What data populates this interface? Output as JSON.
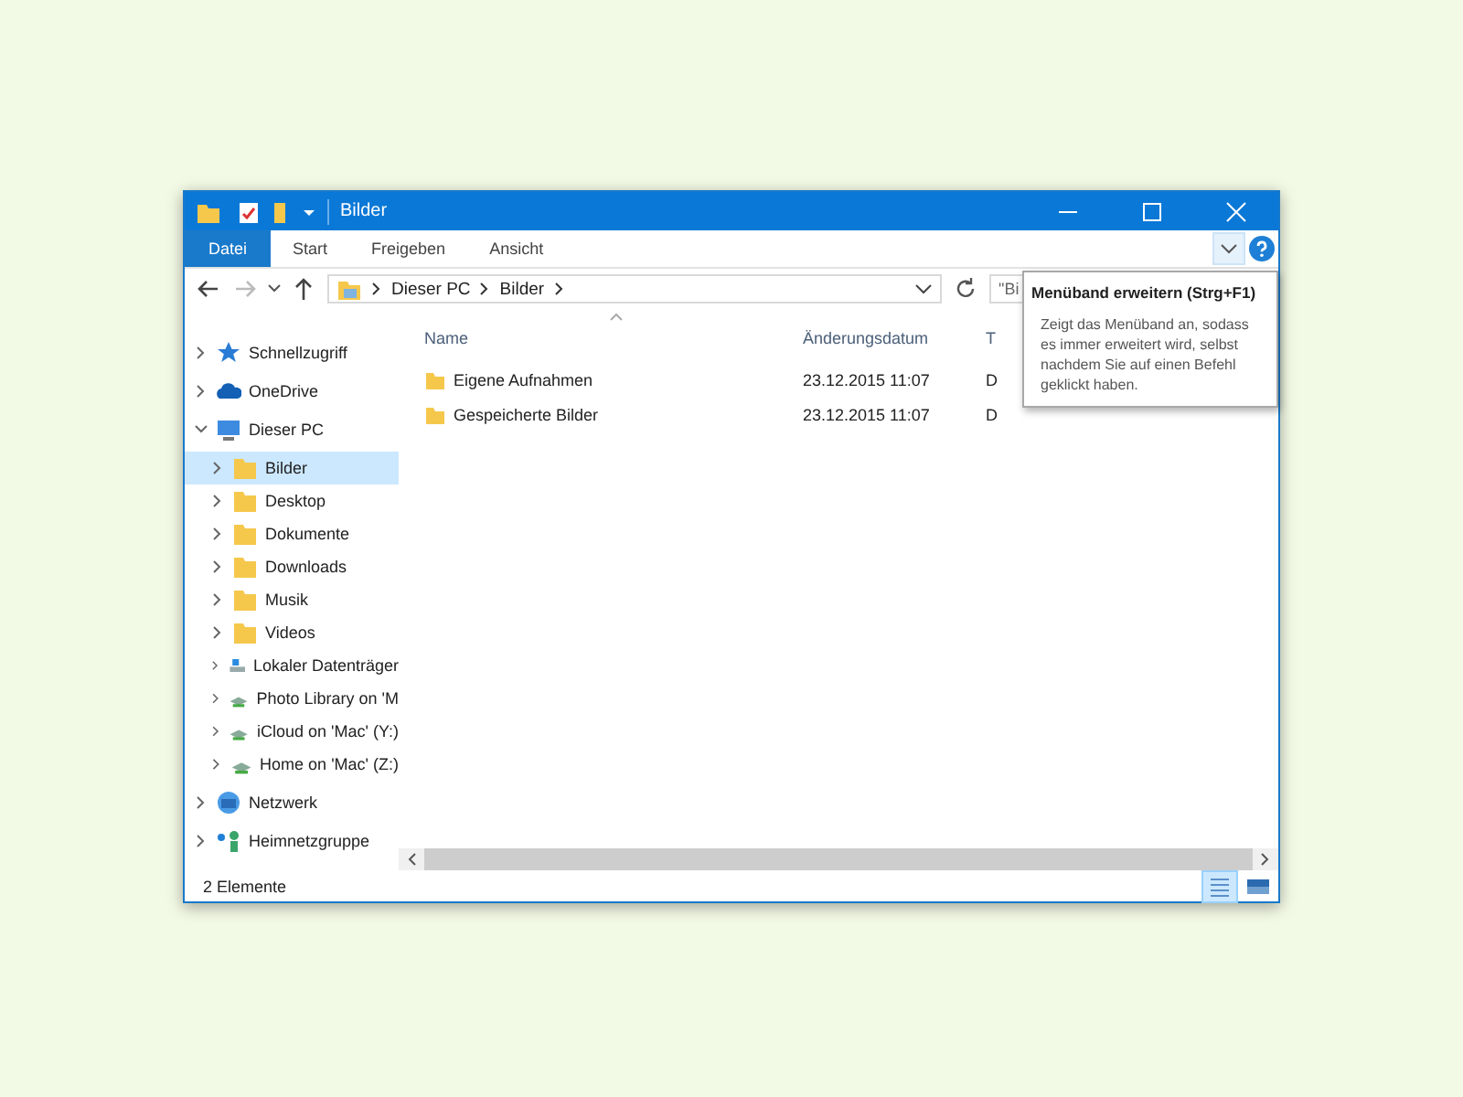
{
  "window": {
    "title": "Bilder"
  },
  "ribbon_tabs": [
    {
      "label": "Datei",
      "selected": true
    },
    {
      "label": "Start",
      "selected": false
    },
    {
      "label": "Freigeben",
      "selected": false
    },
    {
      "label": "Ansicht",
      "selected": false
    }
  ],
  "address": {
    "segments": [
      "Dieser PC",
      "Bilder"
    ]
  },
  "search": {
    "placeholder": "\"Bi"
  },
  "sidebar": {
    "items": [
      {
        "label": "Schnellzugriff",
        "kind": "star",
        "expanded": false
      },
      {
        "label": "OneDrive",
        "kind": "cloud",
        "expanded": false
      },
      {
        "label": "Dieser PC",
        "kind": "pc",
        "expanded": true,
        "children": [
          {
            "label": "Bilder",
            "kind": "folder",
            "selected": true
          },
          {
            "label": "Desktop",
            "kind": "folder",
            "selected": false
          },
          {
            "label": "Dokumente",
            "kind": "folder",
            "selected": false
          },
          {
            "label": "Downloads",
            "kind": "folder",
            "selected": false
          },
          {
            "label": "Musik",
            "kind": "folder",
            "selected": false
          },
          {
            "label": "Videos",
            "kind": "folder",
            "selected": false
          },
          {
            "label": "Lokaler Datenträger",
            "kind": "drive",
            "selected": false
          },
          {
            "label": "Photo Library on 'M",
            "kind": "netdrive",
            "selected": false
          },
          {
            "label": "iCloud on 'Mac' (Y:)",
            "kind": "netdrive",
            "selected": false
          },
          {
            "label": "Home on 'Mac' (Z:)",
            "kind": "netdrive",
            "selected": false
          }
        ]
      },
      {
        "label": "Netzwerk",
        "kind": "network",
        "expanded": false
      },
      {
        "label": "Heimnetzgruppe",
        "kind": "homegroup",
        "expanded": false
      }
    ]
  },
  "table": {
    "columns": [
      "Name",
      "Änderungsdatum",
      "T"
    ],
    "rows": [
      {
        "name": "Eigene Aufnahmen",
        "date": "23.12.2015 11:07",
        "column_3": "D"
      },
      {
        "name": "Gespeicherte Bilder",
        "date": "23.12.2015 11:07",
        "column_3": "D"
      }
    ]
  },
  "tooltip": {
    "title": "Menüband erweitern (Strg+F1)",
    "text": "Zeigt das Menüband an, sodass es immer erweitert wird, selbst nachdem Sie auf einen Befehl geklickt haben."
  },
  "status_bar": {
    "text": "2 Elemente"
  }
}
